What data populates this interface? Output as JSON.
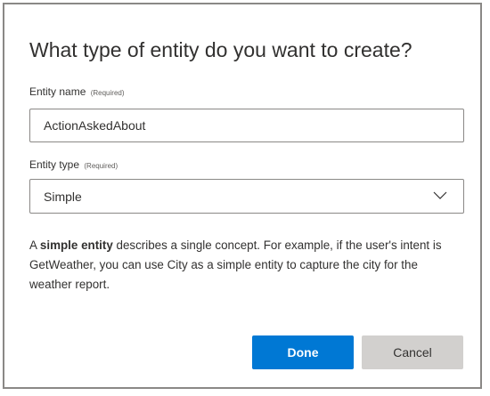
{
  "dialog": {
    "title": "What type of entity do you want to create?",
    "entity_name": {
      "label": "Entity name",
      "required_tag": "(Required)",
      "value": "ActionAskedAbout"
    },
    "entity_type": {
      "label": "Entity type",
      "required_tag": "(Required)",
      "selected": "Simple",
      "icon": "chevron-down-icon"
    },
    "description": {
      "prefix": "A ",
      "bold": "simple entity",
      "suffix": " describes a single concept. For example, if the user's intent is GetWeather, you can use City as a simple entity to capture the city for the weather report."
    },
    "buttons": {
      "done_label": "Done",
      "cancel_label": "Cancel"
    }
  },
  "colors": {
    "primary": "#0078d4",
    "secondary_button": "#d2d0ce",
    "text": "#323130",
    "border": "#8a8886"
  }
}
